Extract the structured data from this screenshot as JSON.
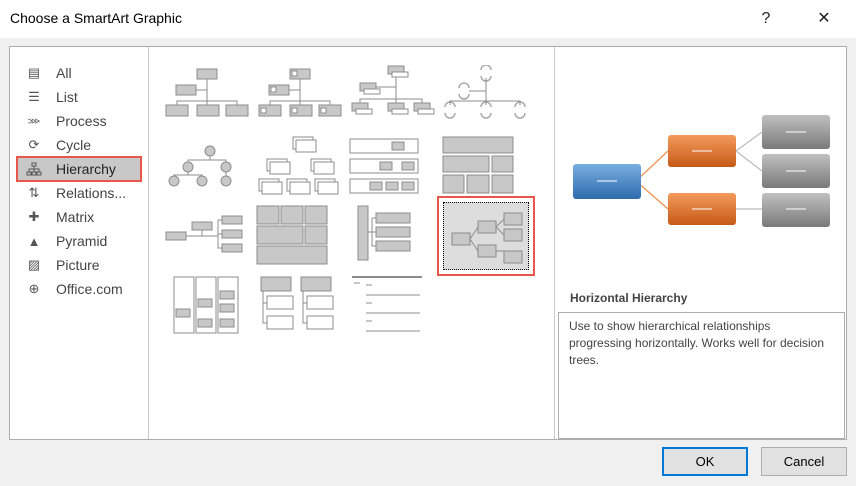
{
  "window": {
    "title": "Choose a SmartArt Graphic",
    "help_label": "?",
    "close_label": "✕"
  },
  "categories": [
    {
      "label": "All",
      "icon": "all-icon"
    },
    {
      "label": "List",
      "icon": "list-icon"
    },
    {
      "label": "Process",
      "icon": "process-icon"
    },
    {
      "label": "Cycle",
      "icon": "cycle-icon"
    },
    {
      "label": "Hierarchy",
      "icon": "hierarchy-icon",
      "selected": true
    },
    {
      "label": "Relations...",
      "icon": "relationship-icon"
    },
    {
      "label": "Matrix",
      "icon": "matrix-icon"
    },
    {
      "label": "Pyramid",
      "icon": "pyramid-icon"
    },
    {
      "label": "Picture",
      "icon": "picture-icon"
    },
    {
      "label": "Office.com",
      "icon": "globe-icon"
    }
  ],
  "preview": {
    "name": "Horizontal Hierarchy",
    "description": "Use to show hierarchical relationships progressing horizontally. Works well for decision trees.",
    "colors": {
      "root": "#3f7fc4",
      "level2": "#e07027",
      "level3": "#8a8a8a"
    }
  },
  "buttons": {
    "ok": "OK",
    "cancel": "Cancel"
  },
  "accent": {
    "selection": "#e8574a",
    "focus": "#0078d7"
  }
}
